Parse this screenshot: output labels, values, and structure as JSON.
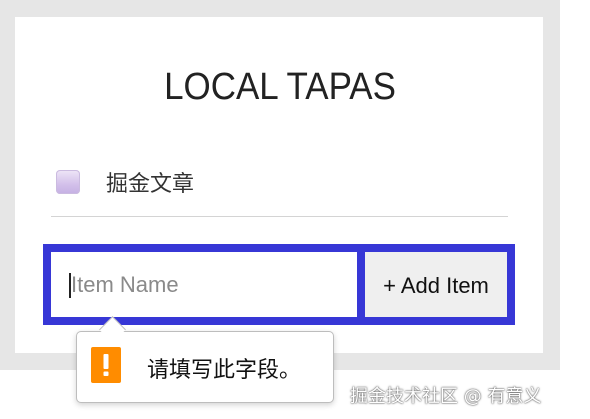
{
  "app": {
    "title": "LOCAL TAPAS"
  },
  "items": [
    {
      "label": "掘金文章",
      "checked": false
    }
  ],
  "form": {
    "input_placeholder": "Item Name",
    "input_value": "",
    "add_label": "+ Add Item"
  },
  "validation": {
    "message": "请填写此字段。",
    "icon": "warning-icon"
  },
  "watermark": {
    "text": "掘金技术社区 @ 有意义"
  },
  "colors": {
    "form_border": "#3737d6",
    "warning": "#ff8c00",
    "page_frame": "#e6e6e6"
  }
}
